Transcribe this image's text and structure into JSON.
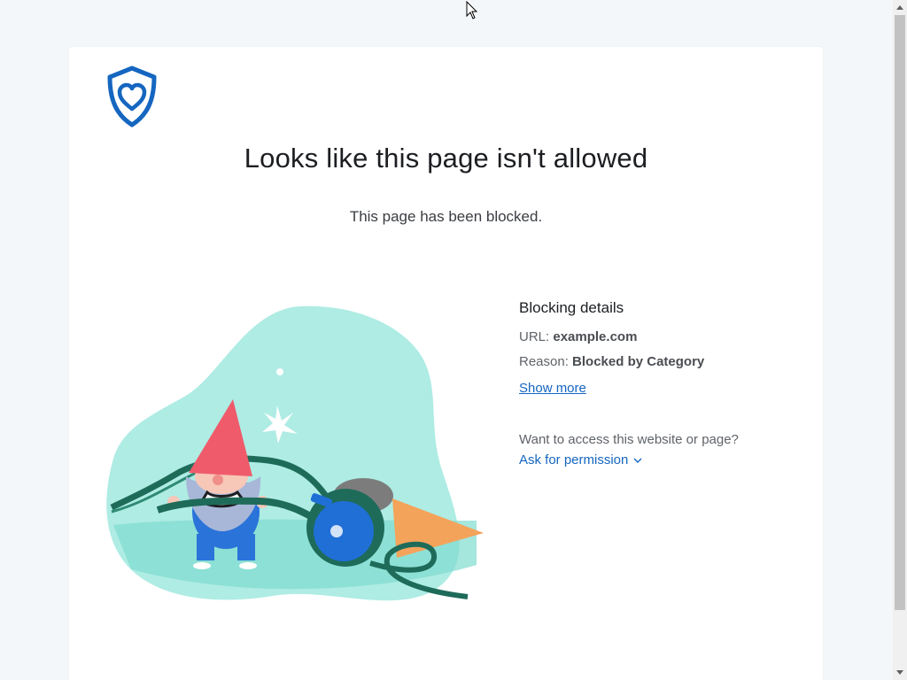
{
  "page": {
    "headline": "Looks like this page isn't allowed",
    "subtitle": "This page has been blocked."
  },
  "logo": {
    "icon": "shield-heart-icon",
    "color": "#1566c0"
  },
  "details": {
    "title": "Blocking details",
    "url_label": "URL:",
    "url_value": "example.com",
    "reason_label": "Reason:",
    "reason_value": "Blocked by Category",
    "show_more": "Show more",
    "access_question": "Want to access this website or page?",
    "ask_permission": "Ask for permission"
  },
  "illustration": {
    "description_icon": "gnome-pulling-hose-icon"
  },
  "colors": {
    "link": "#1566c0",
    "teal_blob": "#aeece4",
    "gnome_hat": "#ef5b6b",
    "hose": "#1e6b5a",
    "reel": "#1f6fd6",
    "cone": "#f4a35a"
  }
}
